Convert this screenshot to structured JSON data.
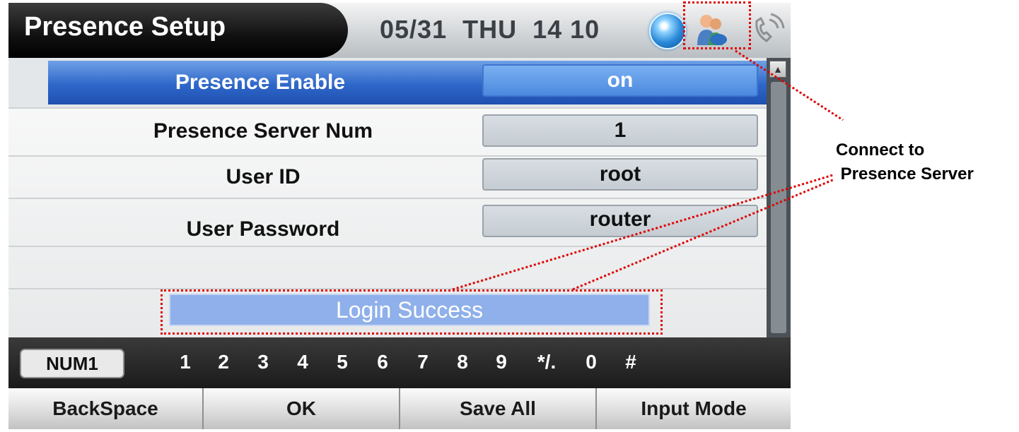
{
  "header": {
    "title": "Presence Setup",
    "datetime": "05/31  THU  14 10",
    "icons": [
      "globe-icon",
      "presence-user-icon",
      "phone-call-icon"
    ]
  },
  "settings": [
    {
      "label": "Presence Enable",
      "value": "on",
      "selected": true
    },
    {
      "label": "Presence Server Num",
      "value": "1"
    },
    {
      "label": "User ID",
      "value": "root"
    },
    {
      "label": "User Password",
      "value": "router"
    }
  ],
  "status": {
    "message": "Login Success"
  },
  "keypad": {
    "mode": "NUM1",
    "keys": [
      "1",
      "2",
      "3",
      "4",
      "5",
      "6",
      "7",
      "8",
      "9",
      "*/.",
      "0",
      "#"
    ]
  },
  "buttons": [
    "BackSpace",
    "OK",
    "Save All",
    "Input Mode"
  ],
  "annotation": {
    "text": "Connect to\n Presence Server",
    "color": "#e00000"
  },
  "colors": {
    "selection": "#2e67c9",
    "status_bg": "#8fb0ea",
    "annotation": "#e00000"
  }
}
